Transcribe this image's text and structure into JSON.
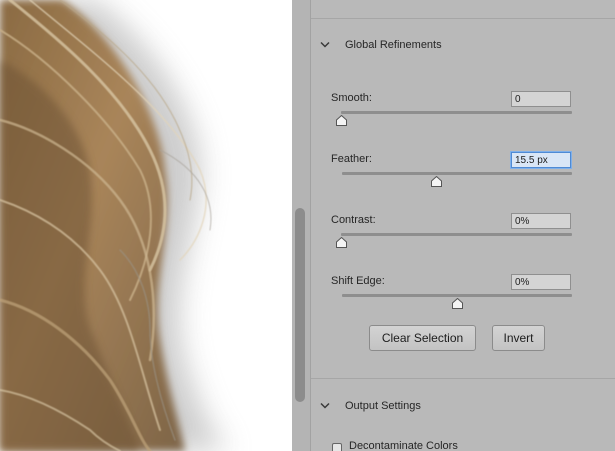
{
  "canvas": {
    "image_description_icon": "hair-photo"
  },
  "panel": {
    "global_refinements": {
      "title": "Global Refinements",
      "expanded": true,
      "rows": [
        {
          "key": "smooth",
          "label": "Smooth:",
          "value": "0",
          "slider_fraction": 0.0
        },
        {
          "key": "feather",
          "label": "Feather:",
          "value": "15.5 px",
          "slider_fraction": 0.41,
          "focused": true
        },
        {
          "key": "contrast",
          "label": "Contrast:",
          "value": "0%",
          "slider_fraction": 0.0
        },
        {
          "key": "shift_edge",
          "label": "Shift Edge:",
          "value": "0%",
          "slider_fraction": 0.5
        }
      ],
      "buttons": {
        "clear_selection": "Clear Selection",
        "invert": "Invert"
      }
    },
    "output_settings": {
      "title": "Output Settings",
      "expanded": true,
      "decontaminate_label": "Decontaminate Colors",
      "decontaminate_checked": false
    }
  },
  "colors": {
    "panel_bg": "#b9b9b9",
    "focus_accent": "#4f8ad4",
    "slider_track": "#8e8e8e"
  }
}
